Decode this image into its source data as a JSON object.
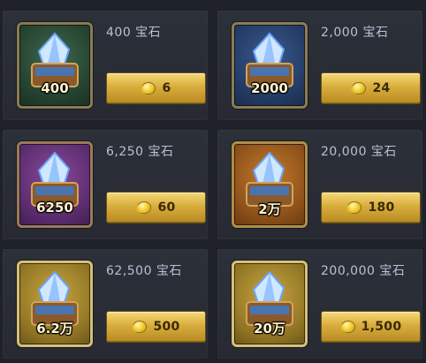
{
  "offers": [
    {
      "amount_label": "400",
      "title": "400 宝石",
      "price": "6",
      "frame": "green"
    },
    {
      "amount_label": "2000",
      "title": "2,000 宝石",
      "price": "24",
      "frame": "blue"
    },
    {
      "amount_label": "6250",
      "title": "6,250 宝石",
      "price": "60",
      "frame": "purple"
    },
    {
      "amount_label": "2万",
      "title": "20,000 宝石",
      "price": "180",
      "frame": "orange"
    },
    {
      "amount_label": "6.2万",
      "title": "62,500 宝石",
      "price": "500",
      "frame": "gold"
    },
    {
      "amount_label": "20万",
      "title": "200,000 宝石",
      "price": "1,500",
      "frame": "gold"
    }
  ],
  "icons": {
    "item": "gem-chest-icon",
    "currency": "gold-coin-icon"
  }
}
